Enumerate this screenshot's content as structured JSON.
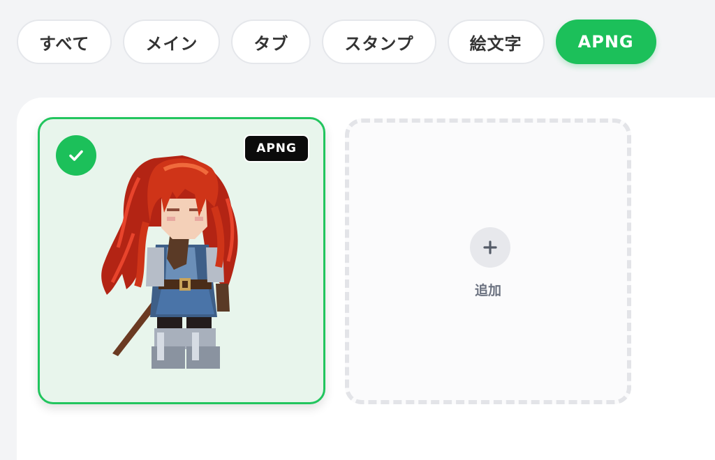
{
  "tabs": [
    {
      "label": "すべて",
      "active": false
    },
    {
      "label": "メイン",
      "active": false
    },
    {
      "label": "タブ",
      "active": false
    },
    {
      "label": "スタンプ",
      "active": false
    },
    {
      "label": "絵文字",
      "active": false
    },
    {
      "label": "APNG",
      "active": true
    }
  ],
  "items": [
    {
      "badge": "APNG",
      "selected": true,
      "image": "pixel-art-red-haired-knight-girl"
    }
  ],
  "add_card": {
    "label": "追加",
    "icon": "plus-icon"
  },
  "colors": {
    "accent": "#1cc05a",
    "selected_bg": "#e8f5ec",
    "background": "#f3f4f6"
  }
}
